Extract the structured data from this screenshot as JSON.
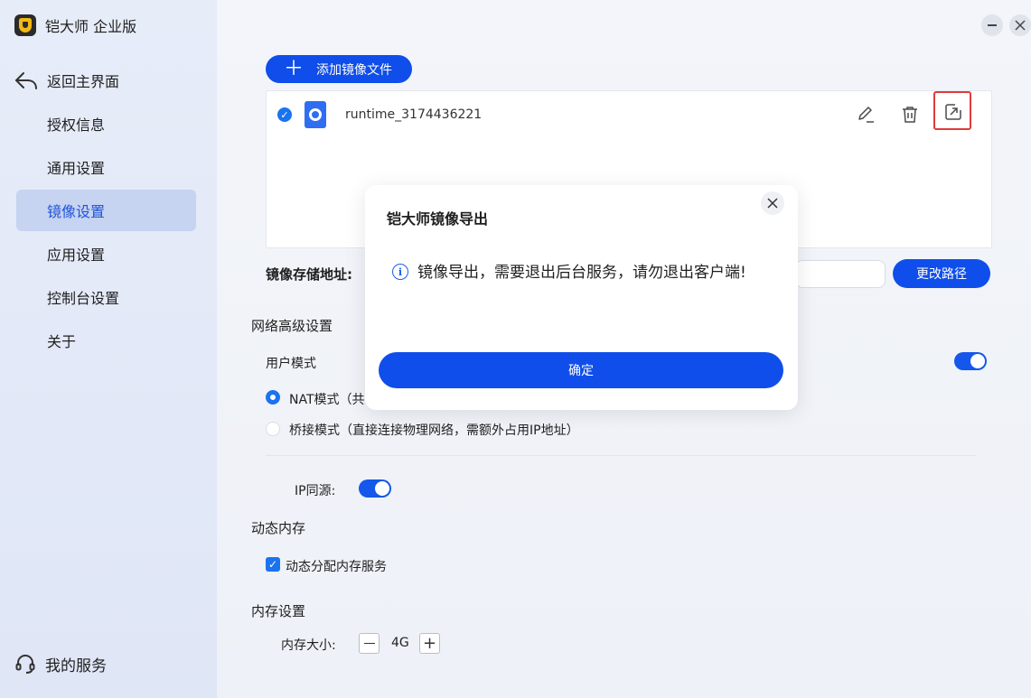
{
  "app": {
    "title": "铠大师 企业版"
  },
  "sidebar": {
    "back": {
      "label": "返回主界面",
      "icon": "back-arrow-icon"
    },
    "items": [
      {
        "label": "授权信息",
        "active": false
      },
      {
        "label": "通用设置",
        "active": false
      },
      {
        "label": "镜像设置",
        "active": true
      },
      {
        "label": "应用设置",
        "active": false
      },
      {
        "label": "控制台设置",
        "active": false
      },
      {
        "label": "关于",
        "active": false
      }
    ],
    "service": {
      "label": "我的服务",
      "icon": "headset-icon"
    }
  },
  "toolbar": {
    "add_label": "添加镜像文件"
  },
  "files": [
    {
      "name": "runtime_3174436221",
      "checked": true
    }
  ],
  "storage": {
    "label": "镜像存储地址:",
    "change_label": "更改路径"
  },
  "network": {
    "title": "网络高级设置",
    "user_mode_label": "用户模式",
    "user_mode_enabled": true,
    "nat_label": "NAT模式（共",
    "bridge_label": "桥接模式（直接连接物理网络，需额外占用IP地址）",
    "selected_mode": "NAT",
    "ip_same_label": "IP同源:",
    "ip_same_enabled": true
  },
  "dynamic_memory": {
    "title": "动态内存",
    "checkbox_label": "动态分配内存服务",
    "checked": true
  },
  "memory": {
    "title": "内存设置",
    "size_label": "内存大小:",
    "size_value": "4G"
  },
  "dialog": {
    "title": "铠大师镜像导出",
    "message": "镜像导出，需要退出后台服务，请勿退出客户端!",
    "ok_label": "确定"
  },
  "colors": {
    "primary": "#0f4eea",
    "active_nav_bg": "#c6d3f1",
    "highlight_border": "#e03a3a"
  }
}
